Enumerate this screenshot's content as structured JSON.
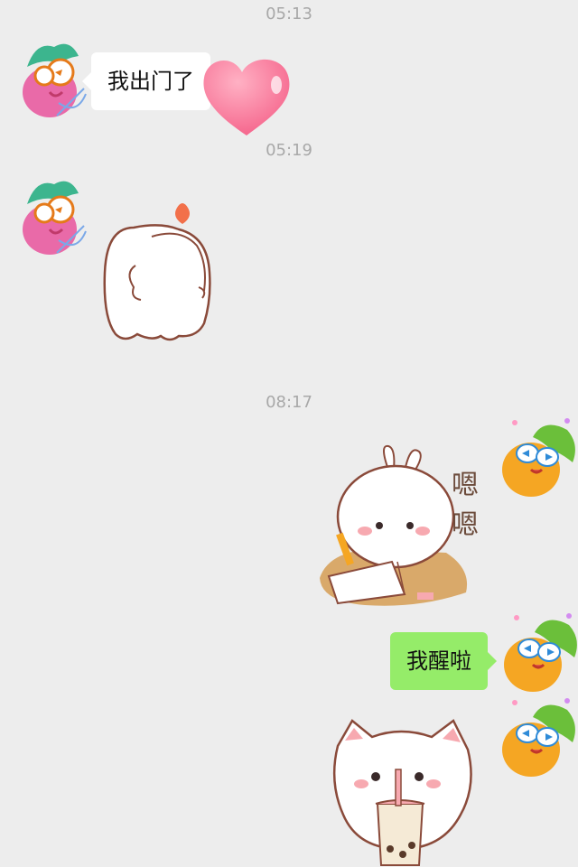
{
  "messages": [
    {
      "type": "time",
      "text": "05:13"
    },
    {
      "type": "text",
      "side": "left",
      "text": "我出门了"
    },
    {
      "type": "time",
      "text": "05:19"
    },
    {
      "type": "sticker",
      "side": "left",
      "sticker": "white-blob-hug-sticker"
    },
    {
      "type": "time",
      "text": "08:17"
    },
    {
      "type": "sticker",
      "side": "right",
      "sticker": "bunny-writing-sticker",
      "caption_line1": "嗯",
      "caption_line2": "嗯"
    },
    {
      "type": "text",
      "side": "right",
      "text": "我醒啦"
    },
    {
      "type": "sticker",
      "side": "right",
      "sticker": "cat-drinking-boba-sticker"
    }
  ],
  "colors": {
    "background": "#ededed",
    "bubble_left": "#ffffff",
    "bubble_right": "#95ec69",
    "timestamp": "#a8a8a8"
  }
}
